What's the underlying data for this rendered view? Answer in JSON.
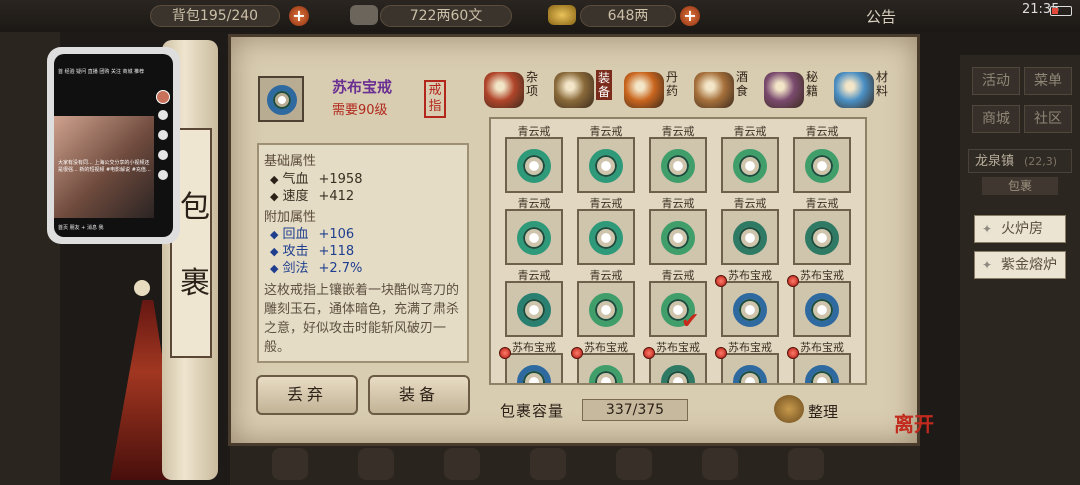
{
  "topbar": {
    "bag_capacity": "背包195/240",
    "money_wen": "722两60文",
    "money_liang": "648两",
    "announce": "公告",
    "clock": "21:35"
  },
  "right_menu": {
    "buttons": [
      "活动",
      "菜单",
      "商城",
      "社区"
    ],
    "town": "龙泉镇",
    "town_coords": "(22,3)",
    "town_sub": "包裹",
    "facilities": [
      "火炉房",
      "紫金熔炉"
    ]
  },
  "scroll": {
    "chars": [
      "包",
      "裹"
    ]
  },
  "item": {
    "name": "苏布宝戒",
    "requirement": "需要90级",
    "seal": [
      "戒",
      "指"
    ],
    "base_title": "基础属性",
    "base_stats": [
      {
        "label": "气血",
        "value": "+1958"
      },
      {
        "label": "速度",
        "value": "+412"
      }
    ],
    "extra_title": "附加属性",
    "extra_stats": [
      {
        "label": "回血",
        "value": "+106"
      },
      {
        "label": "攻击",
        "value": "+118"
      },
      {
        "label": "剑法",
        "value": "+2.7%"
      }
    ],
    "description": "这枚戒指上镶嵌着一块酷似弯刀的雕刻玉石，通体暗色，充满了肃杀之意，好似攻击时能斩风破刃一般。",
    "discard_label": "丢弃",
    "equip_label": "装备"
  },
  "tabs": [
    {
      "label": "杂项",
      "icon": "jar-icon",
      "color": "#b0452a",
      "active": false
    },
    {
      "label": "装备",
      "icon": "sword-icon",
      "color": "#8a6a3a",
      "active": true
    },
    {
      "label": "丹药",
      "icon": "pill-icon",
      "color": "#c9651e",
      "active": false
    },
    {
      "label": "酒食",
      "icon": "wine-icon",
      "color": "#a6703b",
      "active": false
    },
    {
      "label": "秘籍",
      "icon": "book-icon",
      "color": "#7a4a6e",
      "active": false
    },
    {
      "label": "材料",
      "icon": "crystal-icon",
      "color": "#4a8fc4",
      "active": false
    }
  ],
  "grid": {
    "rows": [
      {
        "names": [
          "青云戒",
          "青云戒",
          "青云戒",
          "青云戒",
          "青云戒"
        ],
        "ring": [
          "#2f9a7a",
          "#2f9a7a",
          "#3f9e6a",
          "#3f9e6a",
          "#3f9e6a"
        ],
        "pips": [
          false,
          false,
          false,
          false,
          false
        ]
      },
      {
        "names": [
          "青云戒",
          "青云戒",
          "青云戒",
          "青云戒",
          "青云戒"
        ],
        "ring": [
          "#2f9a7a",
          "#2f9a7a",
          "#3f9e6a",
          "#2e7a64",
          "#2e7a64"
        ],
        "pips": [
          false,
          false,
          false,
          false,
          false
        ]
      },
      {
        "names": [
          "青云戒",
          "青云戒",
          "青云戒",
          "苏布宝戒",
          "苏布宝戒"
        ],
        "ring": [
          "#2a8070",
          "#3f9e6a",
          "#3f9e6a",
          "#2e6aa0",
          "#2e6aa0"
        ],
        "pips": [
          false,
          false,
          false,
          true,
          true
        ]
      },
      {
        "names": [
          "苏布宝戒",
          "苏布宝戒",
          "苏布宝戒",
          "苏布宝戒",
          "苏布宝戒"
        ],
        "ring": [
          "#2e6aa0",
          "#3f9e6a",
          "#2e7a64",
          "#2e6aa0",
          "#2e6aa0"
        ],
        "pips": [
          true,
          true,
          true,
          true,
          true
        ]
      }
    ],
    "checked_cell": "2-2"
  },
  "capacity": {
    "label": "包裹容量",
    "value": "337/375"
  },
  "sort_label": "整理",
  "leave_label": "离开",
  "phone": {
    "tabs": "首 经验 疑问 直播 团购 关注 商城 推荐",
    "caption": "大家有没有同... 上海公交分享的小视频还是很强... 新的短视频 #电影解说 #充值...",
    "bottom": "首页   朋友   +   消息   我"
  },
  "colors": {
    "panel": "#d9cdb1",
    "accent_red": "#b3261b",
    "name_purple": "#6a2f92"
  }
}
